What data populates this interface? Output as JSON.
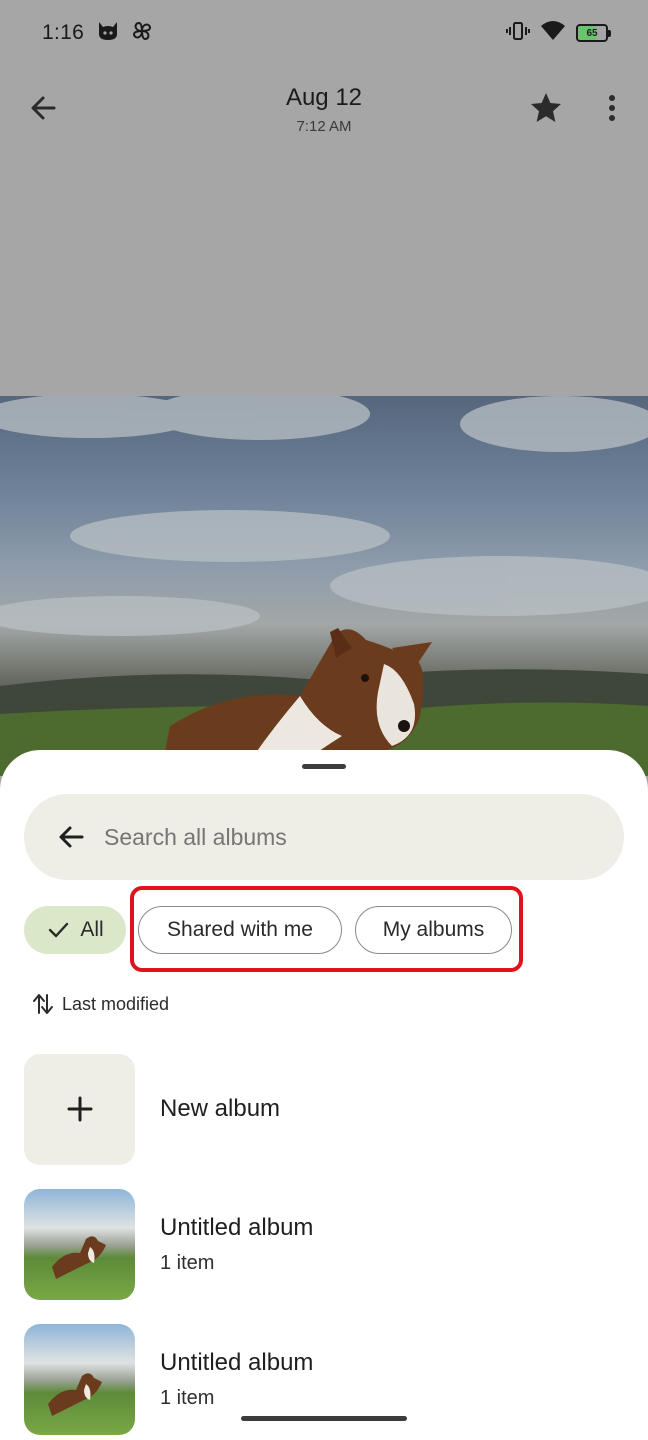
{
  "status_bar": {
    "time": "1:16",
    "battery": "65"
  },
  "header": {
    "title": "Aug 12",
    "subtitle": "7:12 AM"
  },
  "sheet": {
    "search_placeholder": "Search all albums",
    "chips": [
      {
        "label": "All",
        "selected": true
      },
      {
        "label": "Shared with me",
        "selected": false
      },
      {
        "label": "My albums",
        "selected": false
      }
    ],
    "sort_label": "Last modified",
    "new_album_label": "New album",
    "albums": [
      {
        "name": "Untitled album",
        "count": "1 item"
      },
      {
        "name": "Untitled album",
        "count": "1 item"
      }
    ]
  },
  "colors": {
    "dim_overlay": "#a6a6a6",
    "chip_selected": "#dbe7c9",
    "search_bg": "#eeeee6",
    "highlight": "#e0131c"
  },
  "icons": [
    "back-arrow-icon",
    "star-icon",
    "more-vert-icon",
    "check-icon",
    "sort-icon",
    "plus-icon",
    "cat-icon",
    "pinwheel-icon",
    "vibrate-icon",
    "wifi-icon",
    "battery-icon"
  ]
}
